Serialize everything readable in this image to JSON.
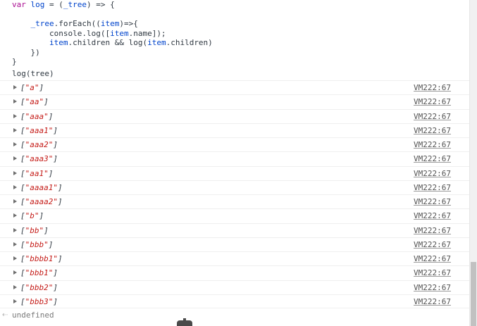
{
  "code": {
    "lines": [
      {
        "parts": [
          {
            "cls": "kw",
            "t": "var"
          },
          {
            "cls": "fn",
            "t": " "
          },
          {
            "cls": "id-blue",
            "t": "log"
          },
          {
            "cls": "fn",
            "t": " = ("
          },
          {
            "cls": "id-blue",
            "t": "_tree"
          },
          {
            "cls": "fn",
            "t": ") => {"
          }
        ]
      },
      {
        "parts": [
          {
            "cls": "fn",
            "t": ""
          }
        ]
      },
      {
        "parts": [
          {
            "cls": "fn",
            "t": "    "
          },
          {
            "cls": "id-blue",
            "t": "_tree"
          },
          {
            "cls": "fn",
            "t": ".forEach(("
          },
          {
            "cls": "id-blue",
            "t": "item"
          },
          {
            "cls": "fn",
            "t": ")=>{"
          }
        ]
      },
      {
        "parts": [
          {
            "cls": "fn",
            "t": "        console.log(["
          },
          {
            "cls": "id-blue",
            "t": "item"
          },
          {
            "cls": "fn",
            "t": ".name]);"
          }
        ]
      },
      {
        "parts": [
          {
            "cls": "fn",
            "t": "        "
          },
          {
            "cls": "id-blue",
            "t": "item"
          },
          {
            "cls": "fn",
            "t": ".children && log("
          },
          {
            "cls": "id-blue",
            "t": "item"
          },
          {
            "cls": "fn",
            "t": ".children)"
          }
        ]
      },
      {
        "parts": [
          {
            "cls": "fn",
            "t": "    })"
          }
        ]
      },
      {
        "parts": [
          {
            "cls": "fn",
            "t": "}"
          }
        ]
      }
    ],
    "command": "log(tree)"
  },
  "rows": [
    {
      "value": "\"a\"",
      "source": "VM222:67"
    },
    {
      "value": "\"aa\"",
      "source": "VM222:67"
    },
    {
      "value": "\"aaa\"",
      "source": "VM222:67"
    },
    {
      "value": "\"aaa1\"",
      "source": "VM222:67"
    },
    {
      "value": "\"aaa2\"",
      "source": "VM222:67"
    },
    {
      "value": "\"aaa3\"",
      "source": "VM222:67"
    },
    {
      "value": "\"aa1\"",
      "source": "VM222:67"
    },
    {
      "value": "\"aaaa1\"",
      "source": "VM222:67"
    },
    {
      "value": "\"aaaa2\"",
      "source": "VM222:67"
    },
    {
      "value": "\"b\"",
      "source": "VM222:67"
    },
    {
      "value": "\"bb\"",
      "source": "VM222:67"
    },
    {
      "value": "\"bbb\"",
      "source": "VM222:67"
    },
    {
      "value": "\"bbbb1\"",
      "source": "VM222:67"
    },
    {
      "value": "\"bbb1\"",
      "source": "VM222:67"
    },
    {
      "value": "\"bbb2\"",
      "source": "VM222:67"
    },
    {
      "value": "\"bbb3\"",
      "source": "VM222:67"
    }
  ],
  "result": {
    "icon": "return-arrow-icon",
    "text": "undefined"
  },
  "colors": {
    "string": "#c41a16",
    "keyword": "#aa0d91",
    "identifier": "#0044cc",
    "link": "#545454"
  }
}
